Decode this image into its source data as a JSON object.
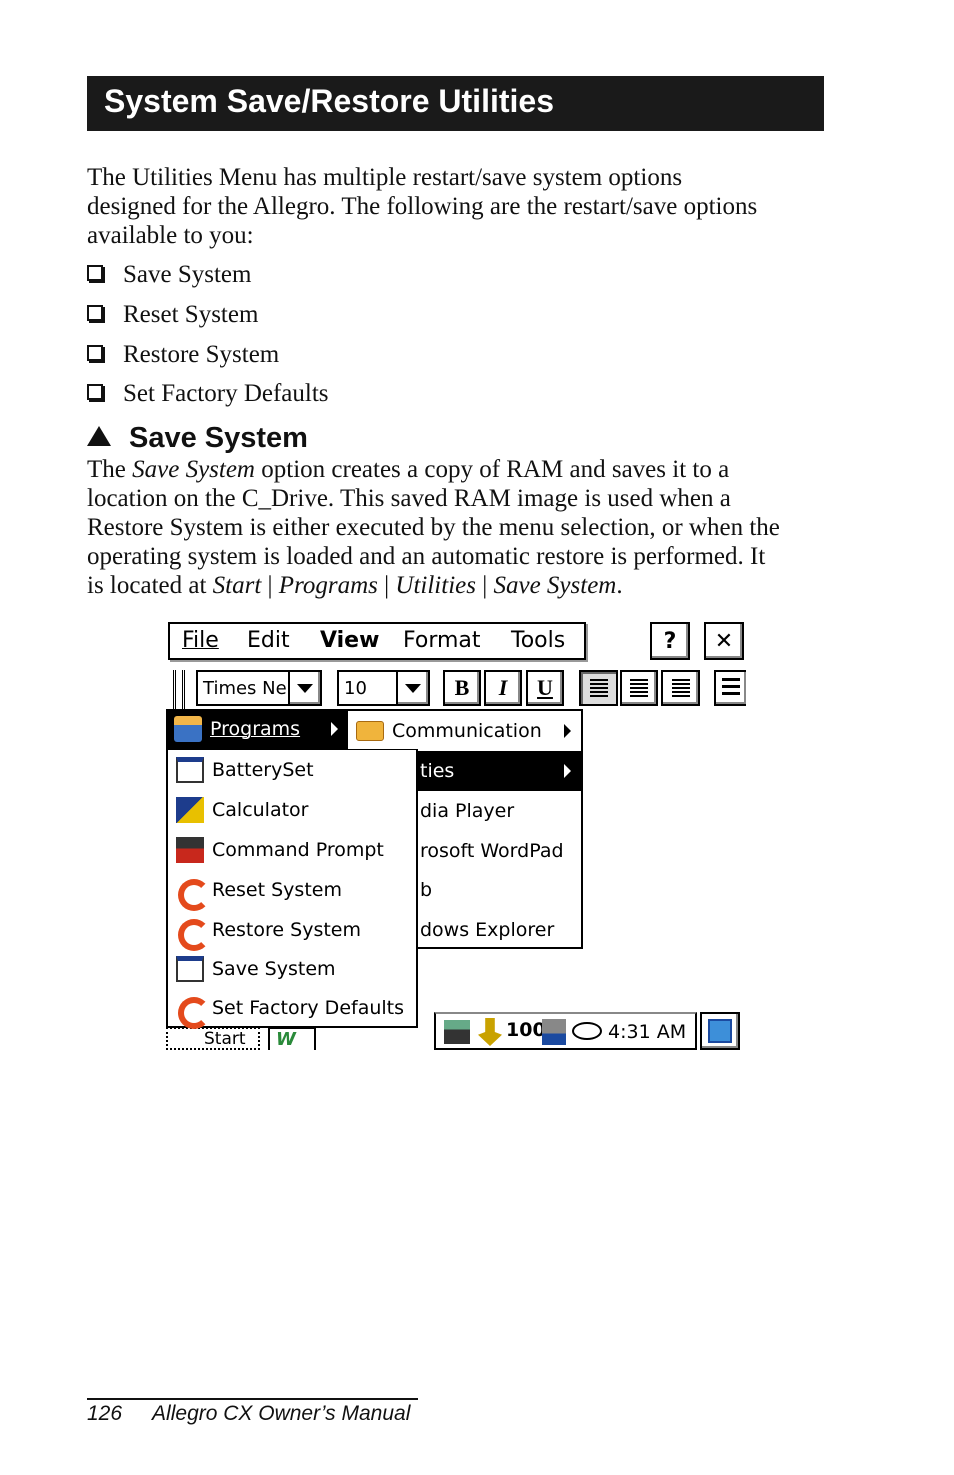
{
  "header": {
    "title": "System Save/Restore Utilities"
  },
  "intro": {
    "lines": [
      "The Utilities Menu has multiple restart/save system options",
      "designed for the Allegro. The following are the restart/save options",
      "available to you:"
    ]
  },
  "bullets": [
    "Save System",
    "Reset System",
    "Restore System",
    "Set Factory Defaults"
  ],
  "section": {
    "title": "Save System",
    "p1_a": "The ",
    "p1_em": "Save System",
    "p1_b": " option creates a copy of RAM and saves it to a",
    "line2": "location on the C_Drive. This saved RAM image is used when a",
    "line3": "Restore System is either executed by the menu selection, or when the",
    "line4": "operating system is loaded and an automatic restore is performed. It",
    "line5_a": "is located at ",
    "path": [
      "Start",
      "Programs",
      "Utilities",
      "Save System"
    ],
    "sep": " | ",
    "end": "."
  },
  "screenshot": {
    "menubar": [
      "File",
      "Edit",
      "View",
      "Format",
      "Tools"
    ],
    "help_label": "?",
    "close_label": "✕",
    "font_value": "Times Ne",
    "size_value": "10",
    "bold": "B",
    "italic": "I",
    "underline": "U",
    "start_menu": {
      "selected": "Programs",
      "items": [
        {
          "label": "BatterySet",
          "icon": "window-icon"
        },
        {
          "label": "Calculator",
          "icon": "calculator-icon"
        },
        {
          "label": "Command Prompt",
          "icon": "msdos-icon"
        },
        {
          "label": "Reset System",
          "icon": "restart-arrow-icon"
        },
        {
          "label": "Restore System",
          "icon": "restart-arrow-icon"
        },
        {
          "label": "Save System",
          "icon": "window-icon"
        },
        {
          "label": "Set Factory Defaults",
          "icon": "restart-arrow-icon"
        }
      ]
    },
    "programs_submenu": [
      "Communication",
      "ties",
      "dia Player",
      "rosoft WordPad",
      "b",
      "dows Explorer"
    ],
    "taskbar": {
      "start": "Start",
      "app": "W",
      "tray_count": "100",
      "clock": "4:31 AM"
    }
  },
  "footer": {
    "page": "126",
    "title": "Allegro CX Owner’s Manual"
  }
}
